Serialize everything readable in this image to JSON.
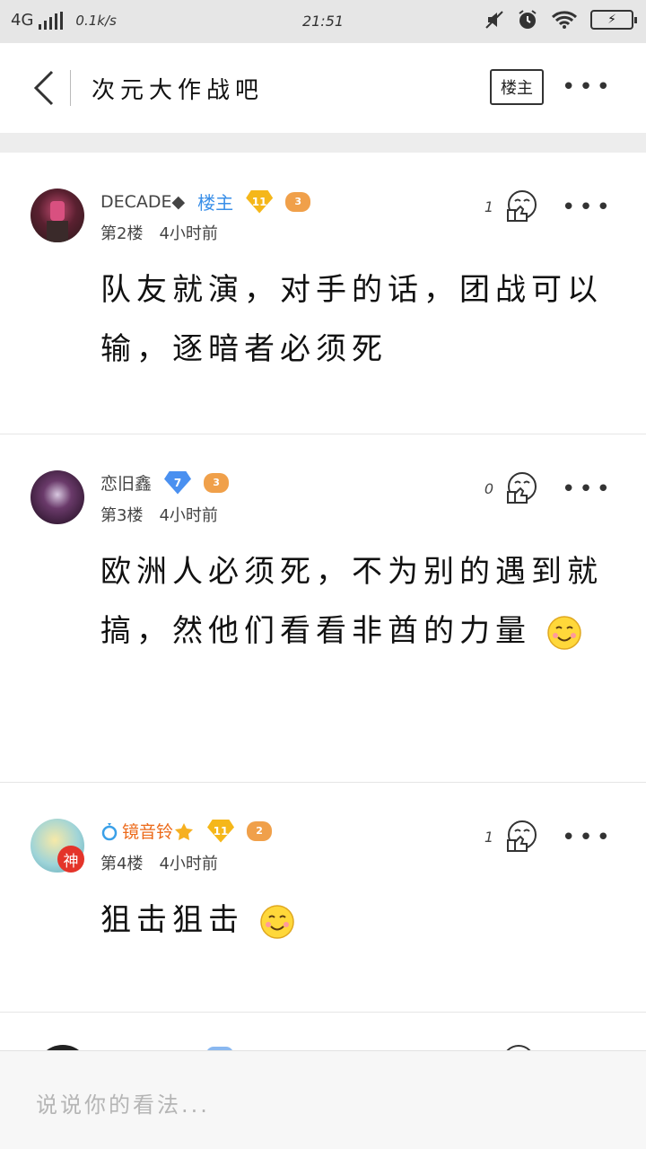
{
  "status_bar": {
    "network": "4G",
    "speed": "0.1k/s",
    "time": "21:51"
  },
  "header": {
    "title": "次元大作战吧",
    "owner_button": "楼主",
    "more": "•••"
  },
  "posts": [
    {
      "username": "DECADE◆",
      "owner_tag": "楼主",
      "level": "11",
      "level_color": "#f5b71a",
      "game_level": "3",
      "floor": "第2楼",
      "time": "4小时前",
      "likes": "1",
      "content": "队友就演，对手的话，团战可以输，逐暗者必须死"
    },
    {
      "username": "恋旧鑫",
      "level": "7",
      "level_color": "#4a90f0",
      "game_level": "3",
      "floor": "第3楼",
      "time": "4小时前",
      "likes": "0",
      "content": "欧洲人必须死，不为别的遇到就搞，然他们看看非酋的力量"
    },
    {
      "username": "镜音铃",
      "level": "11",
      "level_color": "#f5b71a",
      "game_level": "2",
      "avatar_badge": "神",
      "floor": "第4楼",
      "time": "4小时前",
      "likes": "1",
      "content": "狙击狙击"
    }
  ],
  "comment_bar": {
    "placeholder": "说说你的看法..."
  }
}
